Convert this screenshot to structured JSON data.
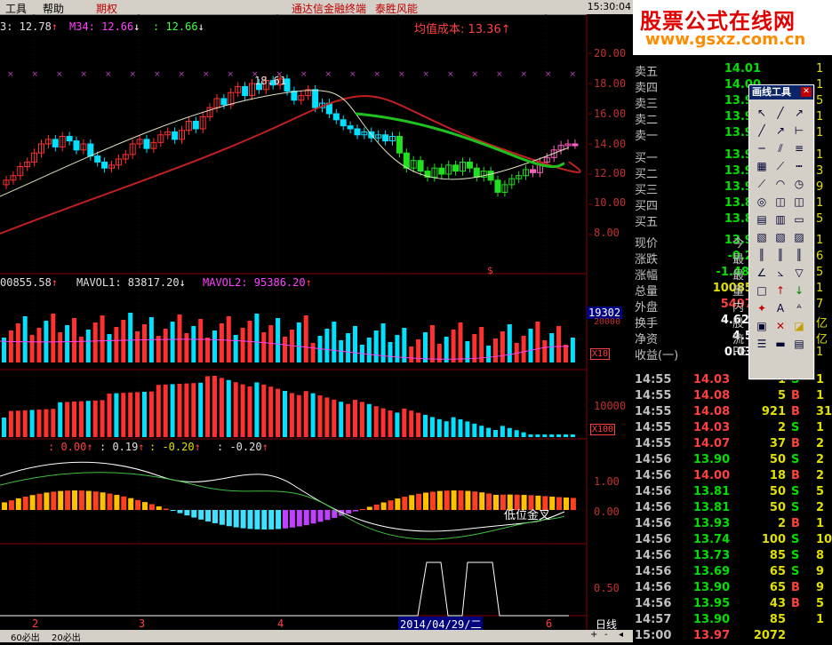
{
  "menubar": {
    "tools": "工具",
    "help": "帮助",
    "futures": "期权",
    "ad1": "通达信金融终端",
    "ad2": "泰胜风能"
  },
  "clock": "15:30:04",
  "watermark": {
    "title": "股票公式在线网",
    "url": "www.gsxz.com.cn"
  },
  "price_panel": {
    "ma_a": "3: 12.78",
    "ma_a_arrow": "↑",
    "ma_b": "M34: 12.66",
    "ma_b_arrow": "↓",
    "ma_c": ": 12.66",
    "ma_c_arrow": "↓",
    "avg_cost": "均值成本: 13.36",
    "avg_cost_arrow": "↑",
    "high_label": "18.61",
    "y_ticks": [
      "20.00",
      "18.00",
      "16.00",
      "14.00",
      "12.00",
      "10.00",
      "8.00"
    ],
    "chart_data": {
      "type": "candlestick",
      "ylim": [
        7.5,
        20.6
      ],
      "y_ticks": [
        20,
        18,
        16,
        14,
        12,
        10,
        8
      ],
      "high_marker": 18.61
    }
  },
  "volume_panel": {
    "vol": "00855.58",
    "vol_arrow": "↑",
    "mavol1": "MAVOL1: 83817.20",
    "mavol1_arrow": "↓",
    "mavol2": "MAVOL2: 95386.20",
    "mavol2_arrow": "↑",
    "cursor_value": "19302",
    "y_tick": "20000",
    "scale": "X10"
  },
  "panel3": {
    "y_tick": "10000",
    "scale": "X100"
  },
  "macd_panel": {
    "v1": ": 0.00",
    "v1_arrow": "↑",
    "v2": ": 0.19",
    "v2_arrow": "↑",
    "v3": ": -0.20",
    "v3_arrow": "↑",
    "v4": ": -0.20",
    "v4_arrow": "↑",
    "annotation": "低位金叉",
    "y_ticks": [
      "1.00",
      "0.00"
    ]
  },
  "signal_panel": {
    "y_tick": "0.50"
  },
  "x_axis": {
    "labels": [
      "2",
      "3",
      "4",
      "5",
      "6"
    ],
    "cursor_date": "2014/04/29/二",
    "period": "日线"
  },
  "bottom_tabs": [
    "60必出",
    "20必出"
  ],
  "quote": {
    "sell": [
      {
        "k": "卖五",
        "v": "14.01",
        "n": "1"
      },
      {
        "k": "卖四",
        "v": "14.00",
        "n": "1"
      },
      {
        "k": "卖三",
        "v": "13.99",
        "n": "5"
      },
      {
        "k": "卖二",
        "v": "13.98",
        "n": "1"
      },
      {
        "k": "卖一",
        "v": "13.97",
        "n": "1"
      }
    ],
    "buy": [
      {
        "k": "买一",
        "v": "13.93",
        "n": "1"
      },
      {
        "k": "买二",
        "v": "13.91",
        "n": "3"
      },
      {
        "k": "买三",
        "v": "13.90",
        "n": "9"
      },
      {
        "k": "买四",
        "v": "13.81",
        "n": "1"
      },
      {
        "k": "买五",
        "v": "13.80",
        "n": "5"
      }
    ],
    "stats": [
      {
        "k": "现价",
        "v": "13.97",
        "r": "今",
        "n": "1"
      },
      {
        "k": "涨跌",
        "v": "-0.21",
        "r": "最",
        "n": "6"
      },
      {
        "k": "涨幅",
        "v": "-1.48%",
        "r": "最",
        "n": "5"
      },
      {
        "k": "总量",
        "v": "100855",
        "r": "量",
        "n": "1"
      },
      {
        "k": "外盘",
        "v": "54978",
        "r": "内",
        "n": "7"
      },
      {
        "k": "换手",
        "v": "4.62%",
        "r": "股",
        "n": "亿"
      },
      {
        "k": "净资",
        "v": "4.50",
        "r": "流",
        "n": "亿"
      },
      {
        "k": "收益(一)",
        "v": "0.039",
        "r": "PE",
        "n": "1"
      }
    ]
  },
  "trades": [
    {
      "t": "14:55",
      "p": "14.03",
      "v": "1",
      "bs": "S",
      "c": "1"
    },
    {
      "t": "14:55",
      "p": "14.08",
      "v": "5",
      "bs": "B",
      "c": "1"
    },
    {
      "t": "14:55",
      "p": "14.08",
      "v": "921",
      "bs": "B",
      "c": "31"
    },
    {
      "t": "14:55",
      "p": "14.03",
      "v": "2",
      "bs": "S",
      "c": "1"
    },
    {
      "t": "14:55",
      "p": "14.07",
      "v": "37",
      "bs": "B",
      "c": "2"
    },
    {
      "t": "14:56",
      "p": "13.90",
      "v": "50",
      "bs": "S",
      "c": "2"
    },
    {
      "t": "14:56",
      "p": "14.00",
      "v": "18",
      "bs": "B",
      "c": "2"
    },
    {
      "t": "14:56",
      "p": "13.81",
      "v": "50",
      "bs": "S",
      "c": "5"
    },
    {
      "t": "14:56",
      "p": "13.81",
      "v": "50",
      "bs": "S",
      "c": "2"
    },
    {
      "t": "14:56",
      "p": "13.93",
      "v": "2",
      "bs": "B",
      "c": "1"
    },
    {
      "t": "14:56",
      "p": "13.74",
      "v": "100",
      "bs": "S",
      "c": "10"
    },
    {
      "t": "14:56",
      "p": "13.73",
      "v": "85",
      "bs": "S",
      "c": "8"
    },
    {
      "t": "14:56",
      "p": "13.69",
      "v": "65",
      "bs": "S",
      "c": "9"
    },
    {
      "t": "14:56",
      "p": "13.90",
      "v": "65",
      "bs": "B",
      "c": "9"
    },
    {
      "t": "14:56",
      "p": "13.95",
      "v": "43",
      "bs": "B",
      "c": "5"
    },
    {
      "t": "14:57",
      "p": "13.90",
      "v": "85",
      "bs": "",
      "c": "1"
    },
    {
      "t": "15:00",
      "p": "13.97",
      "v": "2072",
      "bs": "",
      "c": ""
    }
  ],
  "tool_window": {
    "title": "画线工具",
    "close": "✕"
  },
  "colors": {
    "up": "#ff3030",
    "down": "#00e0ff",
    "green_ma": "#20c020",
    "red_ma": "#c02020",
    "grid": "#800000"
  }
}
